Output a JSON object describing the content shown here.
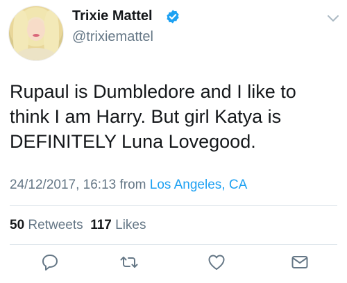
{
  "user": {
    "name": "Trixie Mattel",
    "handle": "@trixiemattel",
    "verified": true,
    "avatar_icon": "profile-avatar"
  },
  "tweet": {
    "text": "Rupaul is Dumbledore and I like to\nthink I am Harry. But girl Katya is\nDEFINITELY Luna Lovegood.",
    "timestamp": "24/12/2017, 16:13",
    "from_label": "from",
    "location": "Los Angeles, CA"
  },
  "stats": {
    "retweets_count": "50",
    "retweets_label": "Retweets",
    "likes_count": "117",
    "likes_label": "Likes"
  },
  "actions": {
    "reply_icon": "reply-icon",
    "retweet_icon": "retweet-icon",
    "like_icon": "heart-icon",
    "dm_icon": "envelope-icon"
  },
  "colors": {
    "accent": "#1da1f2",
    "text": "#14171a",
    "muted": "#657786",
    "divider": "#e1e8ed"
  }
}
